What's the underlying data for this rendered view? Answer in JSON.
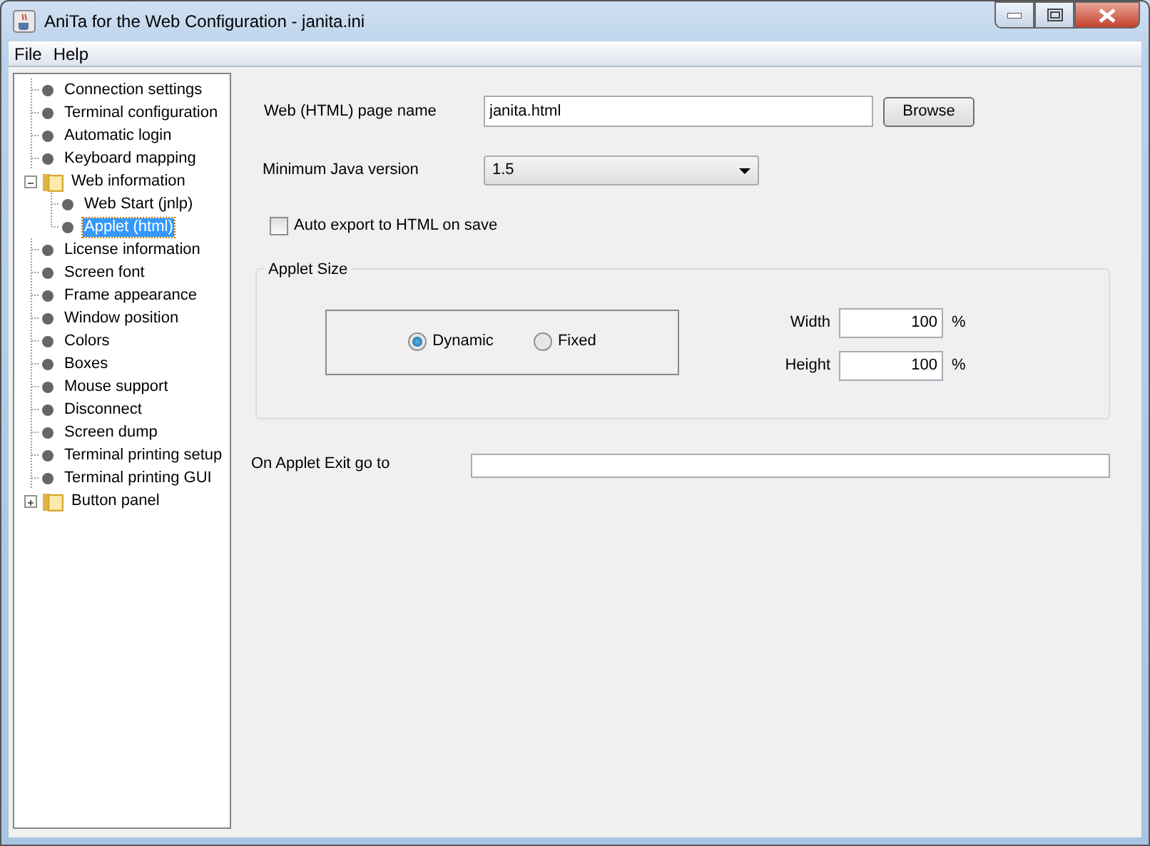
{
  "window": {
    "title": "AniTa for the Web Configuration - janita.ini"
  },
  "menu": [
    "File",
    "Help"
  ],
  "tree": [
    {
      "label": "Connection settings",
      "kind": "leaf",
      "selected": false
    },
    {
      "label": "Terminal configuration",
      "kind": "leaf",
      "selected": false
    },
    {
      "label": "Automatic login",
      "kind": "leaf",
      "selected": false
    },
    {
      "label": "Keyboard mapping",
      "kind": "leaf",
      "selected": false
    },
    {
      "label": "Web information",
      "kind": "folder",
      "selected": false,
      "expanded": true,
      "children": [
        {
          "label": "Web Start (jnlp)",
          "kind": "leaf",
          "selected": false
        },
        {
          "label": "Applet (html)",
          "kind": "leaf",
          "selected": true
        }
      ]
    },
    {
      "label": "License information",
      "kind": "leaf",
      "selected": false
    },
    {
      "label": "Screen font",
      "kind": "leaf",
      "selected": false
    },
    {
      "label": "Frame appearance",
      "kind": "leaf",
      "selected": false
    },
    {
      "label": "Window position",
      "kind": "leaf",
      "selected": false
    },
    {
      "label": "Colors",
      "kind": "leaf",
      "selected": false
    },
    {
      "label": "Boxes",
      "kind": "leaf",
      "selected": false
    },
    {
      "label": "Mouse support",
      "kind": "leaf",
      "selected": false
    },
    {
      "label": "Disconnect",
      "kind": "leaf",
      "selected": false
    },
    {
      "label": "Screen dump",
      "kind": "leaf",
      "selected": false
    },
    {
      "label": "Terminal printing setup",
      "kind": "leaf",
      "selected": false
    },
    {
      "label": "Terminal printing GUI",
      "kind": "leaf",
      "selected": false
    },
    {
      "label": "Button panel",
      "kind": "folder",
      "selected": false,
      "expanded": false
    }
  ],
  "page_name": {
    "label": "Web (HTML) page name",
    "value": "janita.html",
    "button": "Browse"
  },
  "java_version": {
    "label": "Minimum Java version",
    "value": "1.5"
  },
  "auto_export": {
    "label": "Auto export to HTML on save",
    "checked": false
  },
  "applet_size": {
    "title": "Applet Size",
    "modes": [
      {
        "label": "Dynamic",
        "selected": true
      },
      {
        "label": "Fixed",
        "selected": false
      }
    ],
    "width": {
      "label": "Width",
      "value": "100",
      "unit": "%"
    },
    "height": {
      "label": "Height",
      "value": "100",
      "unit": "%"
    }
  },
  "exit": {
    "label": "On Applet Exit go to"
  }
}
